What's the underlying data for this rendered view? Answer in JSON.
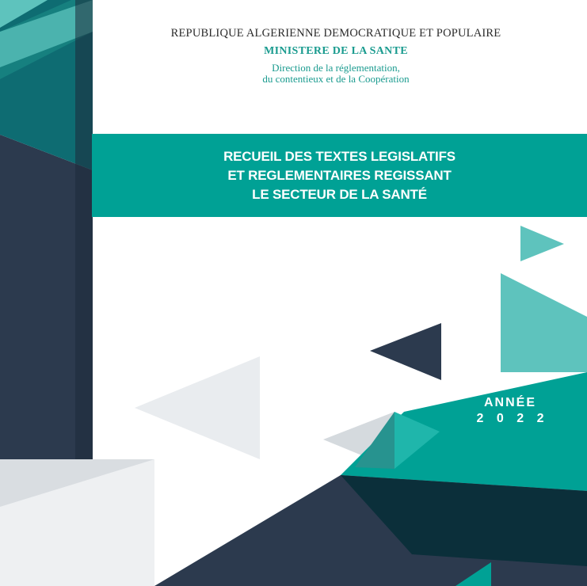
{
  "header": {
    "republic": "REPUBLIQUE ALGERIENNE DEMOCRATIQUE ET POPULAIRE",
    "ministry": "MINISTERE DE LA SANTE",
    "direction_line1": "Direction de la réglementation,",
    "direction_line2": "du contentieux et de la Coopération"
  },
  "title": {
    "line1": "RECUEIL DES TEXTES LEGISLATIFS",
    "line2": "ET REGLEMENTAIRES REGISSANT",
    "line3": "LE SECTEUR DE LA SANTÉ"
  },
  "year": {
    "label": "ANNÉE",
    "value": "2 0 2 2"
  },
  "colors": {
    "teal": "#00a195",
    "light_teal": "#5ec3bd",
    "navy": "#2c3a4e",
    "dark_teal": "#0e6c72",
    "light_gray": "#e9ecef"
  }
}
